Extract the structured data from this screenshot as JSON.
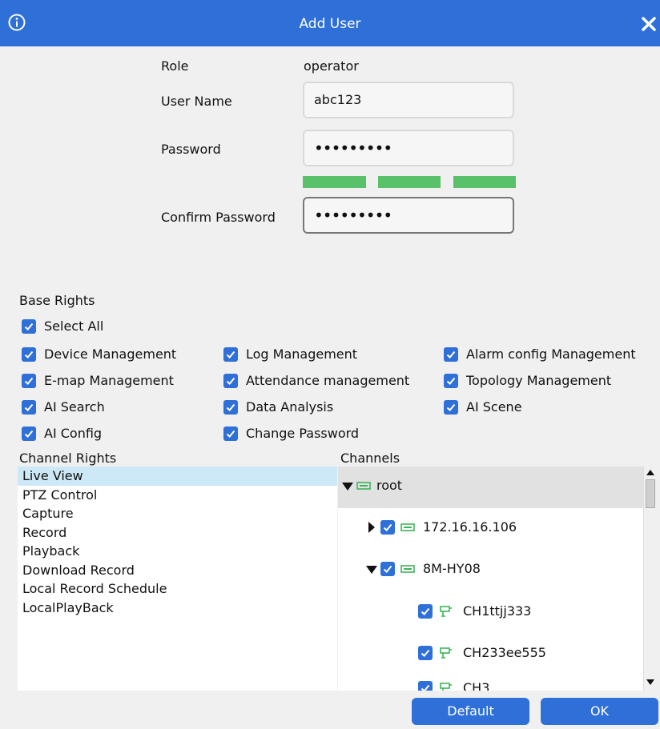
{
  "dialog": {
    "title": "Add User"
  },
  "form": {
    "role_label": "Role",
    "role_value": "operator",
    "username_label": "User Name",
    "username_value": "abc123",
    "password_label": "Password",
    "password_value": "•••••••••",
    "confirm_label": "Confirm Password",
    "confirm_value": "•••••••••",
    "password_strength_bars": 3
  },
  "base_rights": {
    "title": "Base Rights",
    "select_all": {
      "label": "Select All",
      "checked": true
    },
    "items": [
      {
        "label": "Device Management",
        "checked": true
      },
      {
        "label": "Log Management",
        "checked": true
      },
      {
        "label": "Alarm config Management",
        "checked": true
      },
      {
        "label": "E-map Management",
        "checked": true
      },
      {
        "label": "Attendance management",
        "checked": true
      },
      {
        "label": "Topology Management",
        "checked": true
      },
      {
        "label": "AI Search",
        "checked": true
      },
      {
        "label": "Data Analysis",
        "checked": true
      },
      {
        "label": "AI Scene",
        "checked": true
      },
      {
        "label": "AI Config",
        "checked": true
      },
      {
        "label": "Change Password",
        "checked": true
      }
    ]
  },
  "channel_rights": {
    "title": "Channel Rights",
    "selected": "Live View",
    "items": [
      "Live View",
      "PTZ Control",
      "Capture",
      "Record",
      "Playback",
      "Download Record",
      "Local Record Schedule",
      "LocalPlayBack"
    ]
  },
  "channels": {
    "title": "Channels",
    "nodes": [
      {
        "label": "root",
        "expanded": true,
        "checked": null,
        "type": "device"
      },
      {
        "label": "172.16.16.106",
        "expanded": false,
        "checked": true,
        "type": "device"
      },
      {
        "label": "8M-HY08",
        "expanded": true,
        "checked": true,
        "type": "device"
      },
      {
        "label": "CH1ttjj333",
        "checked": true,
        "type": "camera"
      },
      {
        "label": "CH233ee555",
        "checked": true,
        "type": "camera"
      },
      {
        "label": "CH3",
        "checked": true,
        "type": "camera"
      }
    ]
  },
  "buttons": {
    "default_label": "Default",
    "ok_label": "OK"
  },
  "colors": {
    "accent": "#2f6fd8",
    "strength": "#58c16a",
    "selected_row": "#cde8f6",
    "node_icon": "#3cb55a"
  }
}
